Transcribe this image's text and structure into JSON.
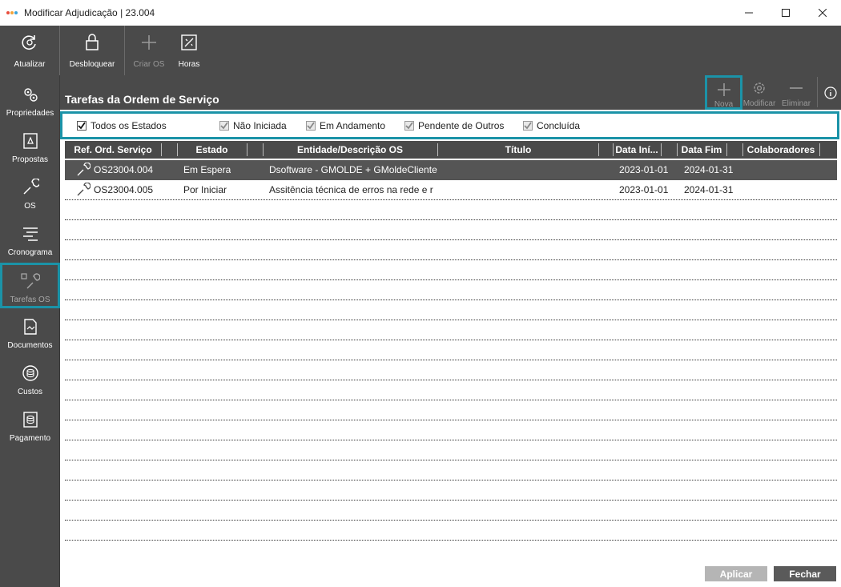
{
  "window": {
    "title": "Modificar Adjudicação | 23.004",
    "minimize": "—",
    "maximize": "☐",
    "close": "✕"
  },
  "toolbar": {
    "refresh": "Atualizar",
    "unlock": "Desbloquear",
    "create_os": "Criar OS",
    "hours": "Horas"
  },
  "sidebar": {
    "items": [
      {
        "label": "Propriedades",
        "icon": "gears-icon"
      },
      {
        "label": "Propostas",
        "icon": "proposal-icon"
      },
      {
        "label": "OS",
        "icon": "wrench-icon"
      },
      {
        "label": "Cronograma",
        "icon": "timeline-icon"
      },
      {
        "label": "Tarefas OS",
        "icon": "tasks-icon"
      },
      {
        "label": "Documentos",
        "icon": "document-icon"
      },
      {
        "label": "Custos",
        "icon": "coins-icon"
      },
      {
        "label": "Pagamento",
        "icon": "payment-icon"
      }
    ]
  },
  "main": {
    "title": "Tarefas da Ordem de Serviço",
    "actions": {
      "new": "Nova",
      "modify": "Modificar",
      "delete": "Eliminar"
    }
  },
  "filters": {
    "all": "Todos os Estados",
    "not_started": "Não Iniciada",
    "in_progress": "Em Andamento",
    "pending_others": "Pendente de Outros",
    "completed": "Concluída"
  },
  "table": {
    "columns": [
      "Ref. Ord. Serviço",
      "Estado",
      "Entidade/Descrição OS",
      "Título",
      "Data Iní...",
      "Data Fim",
      "Colaboradores"
    ],
    "rows": [
      {
        "ref": "OS23004.004",
        "estado": "Em Espera",
        "entidade": "Dsoftware - GMOLDE + GMoldeCliente",
        "titulo": "",
        "inicio": "2023-01-01",
        "fim": "2024-01-31",
        "colab": ""
      },
      {
        "ref": "OS23004.005",
        "estado": "Por Iniciar",
        "entidade": "Assitência técnica de erros na rede e r",
        "titulo": "",
        "inicio": "2023-01-01",
        "fim": "2024-01-31",
        "colab": ""
      }
    ]
  },
  "buttons": {
    "apply": "Aplicar",
    "close": "Fechar"
  },
  "colors": {
    "accent": "#1b93a8",
    "toolbar_bg": "#4a4a4a"
  }
}
